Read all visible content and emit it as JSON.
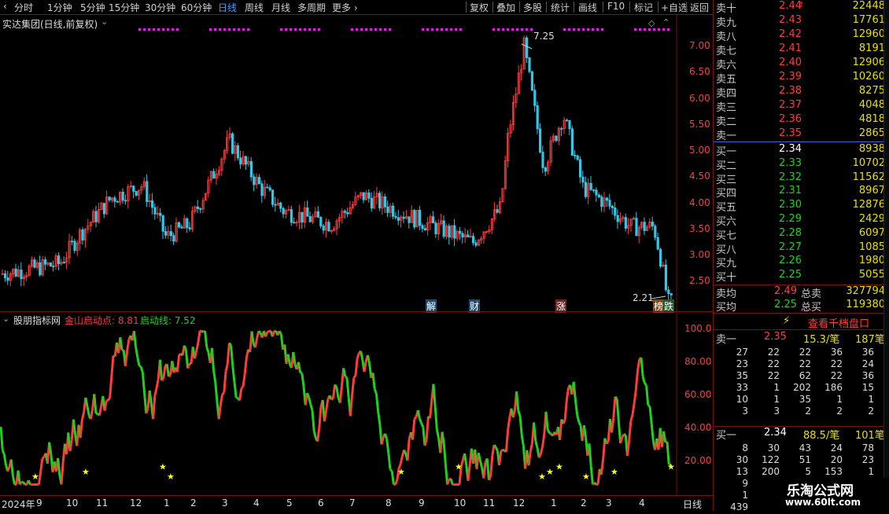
{
  "toolbar": {
    "periods": [
      "分时",
      "1分钟",
      "5分钟",
      "15分钟",
      "30分钟",
      "60分钟",
      "日线",
      "周线",
      "月线",
      "多周期"
    ],
    "selected": "日线",
    "more": "更多 ›",
    "actions": [
      "复权",
      "叠加",
      "多股",
      "统计",
      "画线",
      "F10",
      "标记",
      "+自选",
      "返回"
    ]
  },
  "main_chart": {
    "title": "实达集团(日线,前复权)",
    "price_axis": [
      "7.00",
      "6.50",
      "6.00",
      "5.50",
      "5.00",
      "4.50",
      "4.00",
      "3.50",
      "3.00",
      "2.50"
    ],
    "high_label": "7.25",
    "low_label": "2.21",
    "event_markers": [
      "解",
      "财",
      "涨",
      "榜",
      "跌"
    ]
  },
  "indicator": {
    "title": "股朋指标网",
    "line1_label": "金山启动点: 8.81",
    "line2_label": "启动线: 7.52",
    "axis": [
      "100.0",
      "80.00",
      "60.00",
      "40.00",
      "20.00"
    ]
  },
  "date_axis": {
    "labels": [
      "2024年",
      "9",
      "10",
      "11",
      "12",
      "1",
      "2",
      "3",
      "4",
      "5",
      "6",
      "7",
      "8",
      "9",
      "10",
      "11",
      "12",
      "1",
      "2",
      "3",
      "4"
    ],
    "period": "日线"
  },
  "quote": {
    "asks": [
      {
        "label": "卖十",
        "price": "2.44",
        "vol": "22448"
      },
      {
        "label": "卖九",
        "price": "2.43",
        "vol": "17761"
      },
      {
        "label": "卖八",
        "price": "2.42",
        "vol": "12960"
      },
      {
        "label": "卖七",
        "price": "2.41",
        "vol": "8191"
      },
      {
        "label": "卖六",
        "price": "2.40",
        "vol": "12906"
      },
      {
        "label": "卖五",
        "price": "2.39",
        "vol": "10260"
      },
      {
        "label": "卖四",
        "price": "2.38",
        "vol": "8275"
      },
      {
        "label": "卖三",
        "price": "2.37",
        "vol": "4048"
      },
      {
        "label": "卖二",
        "price": "2.36",
        "vol": "4818"
      },
      {
        "label": "卖一",
        "price": "2.35",
        "vol": "2865"
      }
    ],
    "bids": [
      {
        "label": "买一",
        "price": "2.34",
        "vol": "8938"
      },
      {
        "label": "买二",
        "price": "2.33",
        "vol": "10702"
      },
      {
        "label": "买三",
        "price": "2.32",
        "vol": "11562"
      },
      {
        "label": "买四",
        "price": "2.31",
        "vol": "8967"
      },
      {
        "label": "买五",
        "price": "2.30",
        "vol": "12876"
      },
      {
        "label": "买六",
        "price": "2.29",
        "vol": "2429"
      },
      {
        "label": "买七",
        "price": "2.28",
        "vol": "6097"
      },
      {
        "label": "买八",
        "price": "2.27",
        "vol": "1085"
      },
      {
        "label": "买九",
        "price": "2.26",
        "vol": "1980"
      },
      {
        "label": "买十",
        "price": "2.25",
        "vol": "5055"
      }
    ],
    "avg_sell": {
      "label": "卖均",
      "price": "2.49",
      "total_label": "总卖",
      "total": "327794"
    },
    "avg_buy": {
      "label": "买均",
      "price": "2.25",
      "total_label": "总买",
      "total": "119380"
    },
    "view_thousand": "查看千档盘口",
    "sell1": {
      "label": "卖一",
      "price": "2.35",
      "per": "15.3/笔",
      "count": "187笔"
    },
    "sell1_queue": [
      [
        "27",
        "22",
        "22",
        "36",
        "36"
      ],
      [
        "23",
        "22",
        "22",
        "22",
        "24"
      ],
      [
        "35",
        "22",
        "62",
        "22",
        "36"
      ],
      [
        "33",
        "1",
        "202",
        "186",
        "15"
      ],
      [
        "10",
        "1",
        "35",
        "1",
        "1"
      ],
      [
        "3",
        "3",
        "2",
        "2",
        "2"
      ]
    ],
    "buy1": {
      "label": "买一",
      "price": "2.34",
      "per": "88.5/笔",
      "count": "101笔"
    },
    "buy1_queue": [
      [
        "8",
        "30",
        "43",
        "24",
        "78"
      ],
      [
        "30",
        "122",
        "51",
        "20",
        "23"
      ],
      [
        "13",
        "200",
        "5",
        "153",
        "1"
      ],
      [
        "9",
        "",
        "",
        "",
        ""
      ],
      [
        "1",
        "",
        "",
        "",
        ""
      ],
      [
        "439",
        "",
        "",
        "",
        ""
      ]
    ]
  },
  "watermark": {
    "title": "乐淘公式网",
    "url": "www.60lt.com"
  },
  "colors": {
    "up": "#ff3c3c",
    "down": "#20d020",
    "ask_vol": "#e8e000",
    "selected_tab": "#3aa0ff"
  }
}
